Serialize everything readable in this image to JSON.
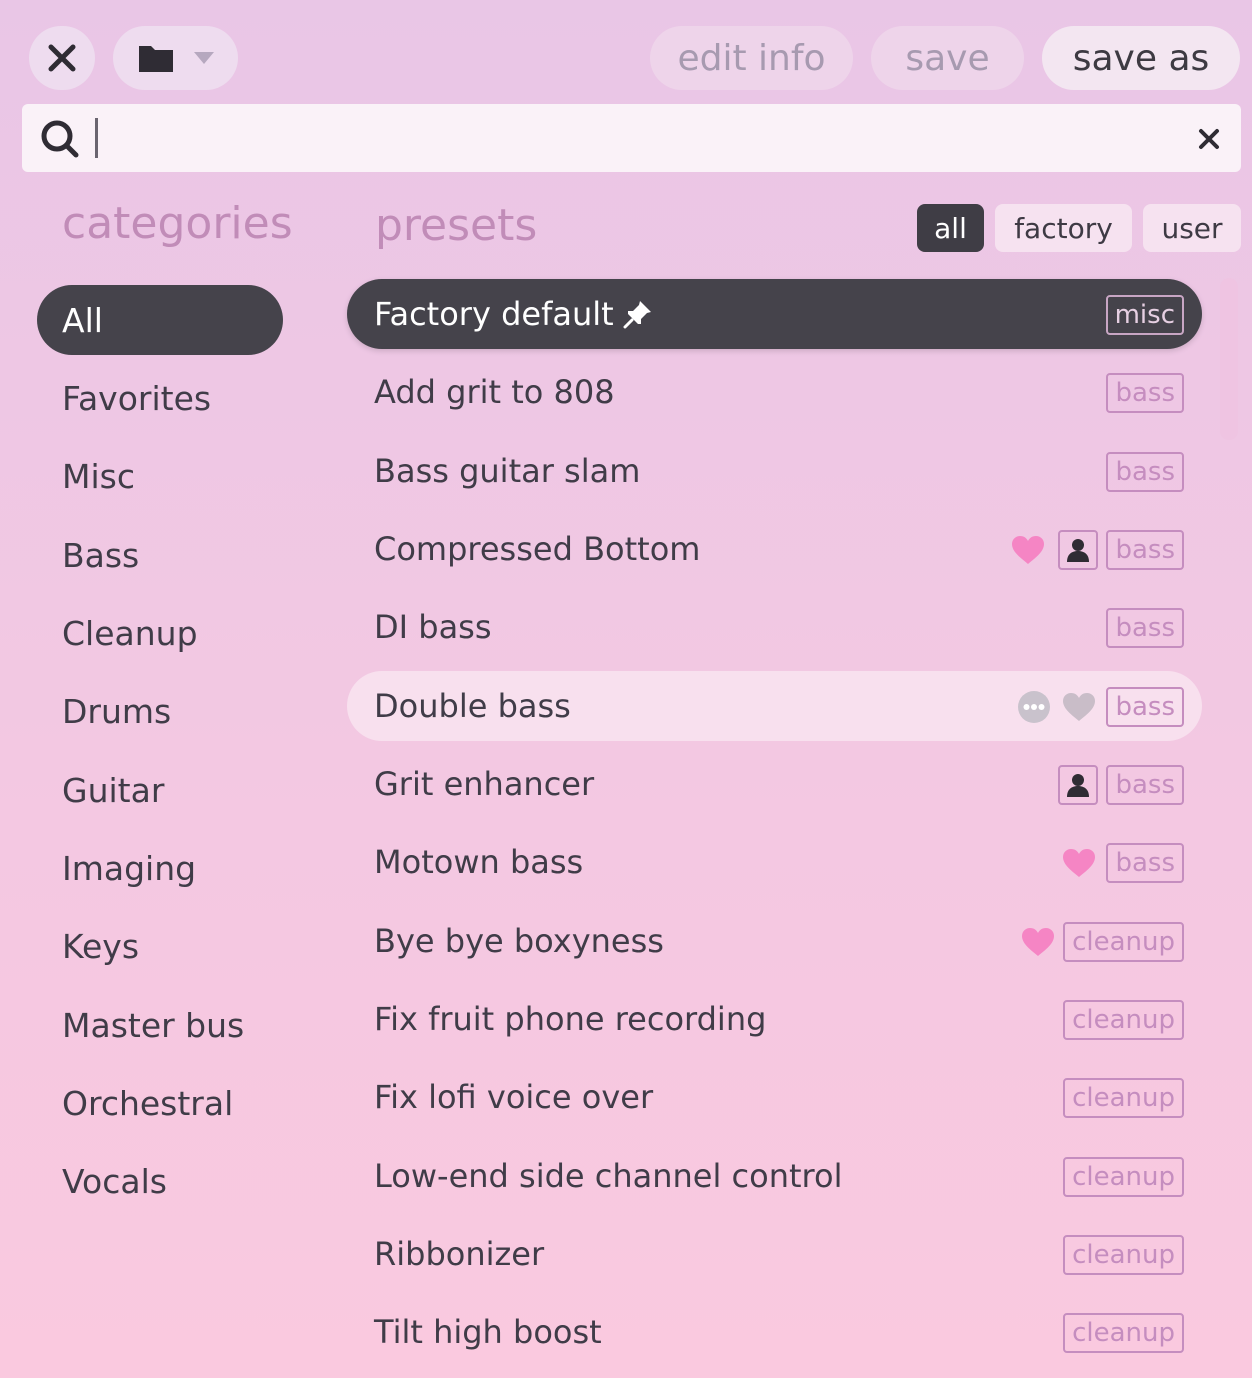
{
  "toolbar": {
    "close_icon": "close-icon",
    "folder_icon": "folder-icon",
    "dropdown_icon": "chevron-down-icon",
    "edit_info_label": "edit info",
    "save_label": "save",
    "save_as_label": "save as"
  },
  "search": {
    "value": "",
    "placeholder": "",
    "search_icon": "search-icon",
    "clear_icon": "close-icon"
  },
  "categories": {
    "title": "categories",
    "items": [
      {
        "label": "All",
        "active": true
      },
      {
        "label": "Favorites"
      },
      {
        "label": "Misc"
      },
      {
        "label": "Bass"
      },
      {
        "label": "Cleanup"
      },
      {
        "label": "Drums"
      },
      {
        "label": "Guitar"
      },
      {
        "label": "Imaging"
      },
      {
        "label": "Keys"
      },
      {
        "label": "Master bus"
      },
      {
        "label": "Orchestral"
      },
      {
        "label": "Vocals"
      }
    ]
  },
  "presets": {
    "title": "presets",
    "filters": [
      {
        "label": "all",
        "active": true
      },
      {
        "label": "factory"
      },
      {
        "label": "user"
      }
    ],
    "items": [
      {
        "name": "Factory default",
        "tag": "misc",
        "pinned": true,
        "active": true
      },
      {
        "name": "Add grit to 808",
        "tag": "bass"
      },
      {
        "name": "Bass guitar slam",
        "tag": "bass"
      },
      {
        "name": "Compressed Bottom",
        "tag": "bass",
        "favorite": true,
        "user": true
      },
      {
        "name": "DI bass",
        "tag": "bass"
      },
      {
        "name": "Double bass",
        "tag": "bass",
        "hover": true,
        "more": true,
        "favorite_outline": true
      },
      {
        "name": "Grit enhancer",
        "tag": "bass",
        "user": true
      },
      {
        "name": "Motown bass",
        "tag": "bass",
        "favorite": true
      },
      {
        "name": "Bye bye boxyness",
        "tag": "cleanup",
        "favorite": true
      },
      {
        "name": "Fix fruit phone recording",
        "tag": "cleanup"
      },
      {
        "name": "Fix lofi voice over",
        "tag": "cleanup"
      },
      {
        "name": "Low-end side channel control",
        "tag": "cleanup"
      },
      {
        "name": "Ribbonizer",
        "tag": "cleanup"
      },
      {
        "name": "Tilt high boost",
        "tag": "cleanup"
      }
    ]
  },
  "colors": {
    "accent_dark": "#45434b",
    "tag": "#c58dbf",
    "heart": "#f585c4"
  }
}
